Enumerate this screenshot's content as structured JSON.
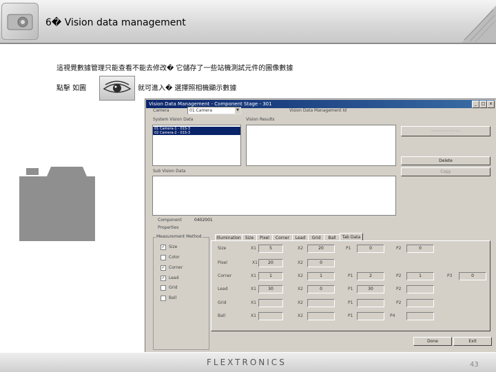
{
  "header": {
    "title": "6� Vision data management"
  },
  "slide": {
    "line1": "這視覺數據管理只能查看不能去修改� 它儲存了一些站機測試元件的圖像數據",
    "click_prefix": "點擊 如圖",
    "click_suffix": "就可進入� 選擇照相機顯示數據"
  },
  "footer": {
    "logo": "FLEXTRONICS",
    "page_number": "43"
  },
  "dialog": {
    "title": "Vision Data Management - Component Stage - 301",
    "close": "x",
    "camera_label": "Camera",
    "camera_value": "01 Camera",
    "vision_label": "Vision Data Management Id",
    "system_vision_label": "System Vision Data",
    "list_items": [
      "01 Camera-1 - 01S-3",
      "02 Camera-2 - 01S-3"
    ],
    "search_label": "Vision Results",
    "delete_label": "Delete",
    "copy_label": "Copy",
    "sub_label": "Sub Vision Data",
    "component_label": "Component",
    "component_value": "0402001",
    "properties_label": "Properties",
    "method_group_label": "Measurement Method",
    "checkboxes": [
      "Size",
      "Color",
      "Corner",
      "Lead",
      "Grid",
      "Ball"
    ],
    "checked": [
      true,
      false,
      true,
      true,
      false,
      false
    ],
    "tabs": [
      "Illumination",
      "Size",
      "Pixel",
      "Corner",
      "Lead",
      "Grid",
      "Ball",
      "Tab Data"
    ],
    "rows": [
      "Size",
      "Pixel",
      "Corner",
      "Lead",
      "Grid",
      "Ball"
    ],
    "col_labels": [
      "X1",
      "X2",
      "P1",
      "P2",
      "P3",
      "P4"
    ],
    "ok_label": "Done",
    "cancel_label": "Exit"
  }
}
